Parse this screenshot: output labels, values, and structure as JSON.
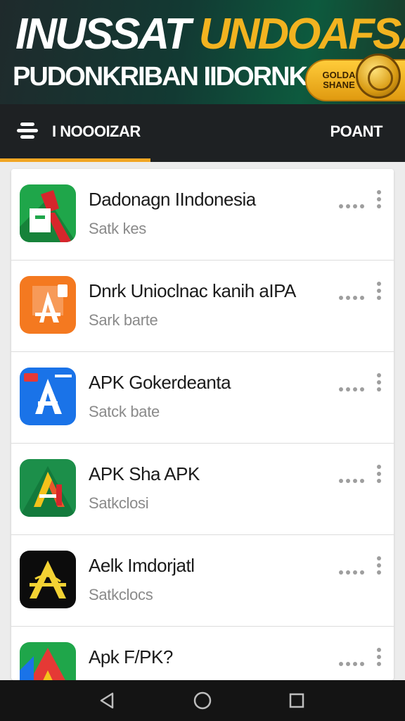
{
  "banner": {
    "headline_word1": "INUSSAT",
    "headline_word2": "UNDOAFSAN",
    "subline": "PUDONKRIBAN IIDORNKAB",
    "badge_text": "GOLDA SHANE",
    "colors": {
      "accent": "#f2b320",
      "background": "#123a33"
    }
  },
  "toolbar": {
    "menu_icon": "menu-icon",
    "title": "I NOOOIZAR",
    "action": "POANT",
    "accent_color": "#f2a623"
  },
  "apps": [
    {
      "title": "Dadonagn IIndonesia",
      "subtitle": "Satk kes",
      "icon": "green-red-apk-icon"
    },
    {
      "title": "Dnrk Unioclnac kanih aIPA",
      "subtitle": "Sark barte",
      "icon": "orange-apk-icon"
    },
    {
      "title": "APK Gokerdeanta",
      "subtitle": "Satck bate",
      "icon": "blue-apk-icon"
    },
    {
      "title": "APK Sha APK",
      "subtitle": "Satkclosi",
      "icon": "green-orange-apk-icon"
    },
    {
      "title": "Aelk Imdorjatl",
      "subtitle": "Satkclocs",
      "icon": "black-gold-apk-icon"
    },
    {
      "title": "Apk F/PK?",
      "subtitle": "",
      "icon": "multicolor-apk-icon"
    }
  ],
  "row_icons": {
    "more_horizontal": "more-dots-icon",
    "more_vertical": "kebab-menu-icon"
  },
  "navbar": {
    "back": "back-icon",
    "home": "home-icon",
    "recents": "recents-icon"
  }
}
